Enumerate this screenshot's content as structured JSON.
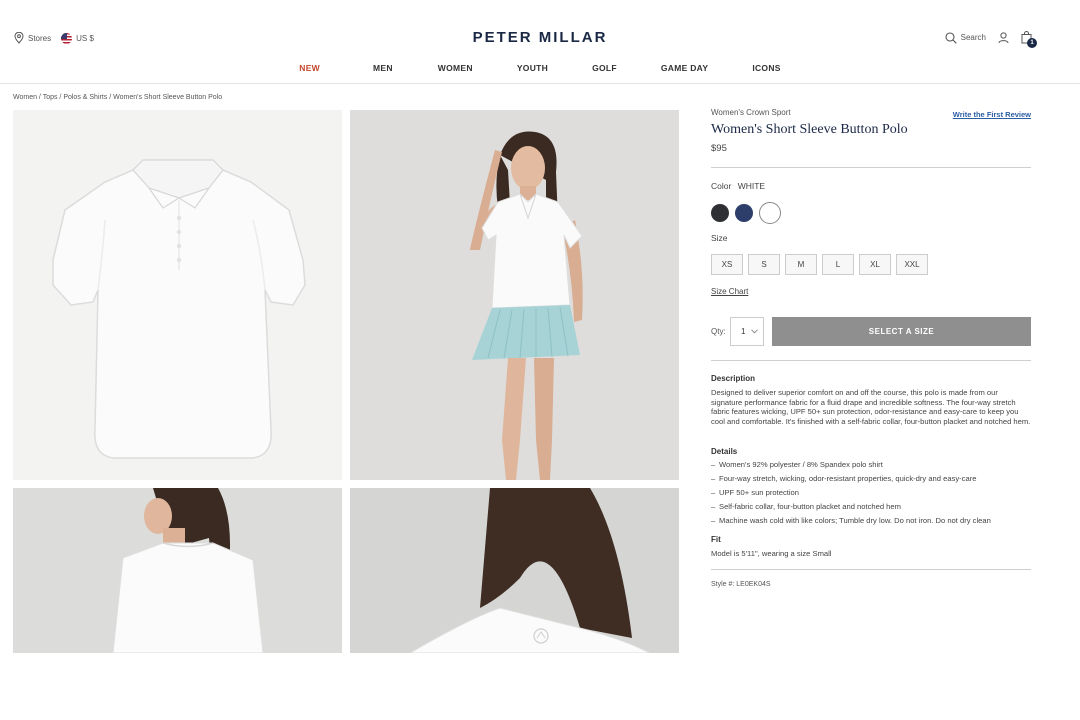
{
  "header": {
    "stores_label": "Stores",
    "currency_label": "US $",
    "logo_text": "PETER MILLAR",
    "search_label": "Search",
    "cart_count": "1"
  },
  "nav": {
    "items": [
      "NEW",
      "MEN",
      "WOMEN",
      "YOUTH",
      "GOLF",
      "GAME DAY",
      "ICONS"
    ],
    "accent_color": "#c5472c"
  },
  "breadcrumb": {
    "text": "Women / Tops / Polos & Shirts / Women's Short Sleeve Button Polo"
  },
  "product": {
    "collection": "Women's Crown Sport",
    "review_link": "Write the First Review",
    "title": "Women's Short Sleeve Button Polo",
    "price": "$95",
    "color_label": "Color",
    "color_value": "WHITE",
    "swatches": [
      "#2f3033",
      "#2d3e6b",
      "#ffffff"
    ],
    "size_label": "Size",
    "sizes": [
      "XS",
      "S",
      "M",
      "L",
      "XL",
      "XXL"
    ],
    "size_chart_label": "Size Chart",
    "qty_label": "Qty:",
    "qty_value": "1",
    "add_button_label": "SELECT A SIZE",
    "description_heading": "Description",
    "description": "Designed to deliver superior comfort on and off the course, this polo is made from our signature performance fabric for a fluid drape and incredible softness. The four-way stretch fabric features wicking, UPF 50+ sun protection, odor-resistance and easy-care to keep you cool and comfortable. It's finished with a self-fabric collar, four-button placket and notched hem.",
    "details_heading": "Details",
    "details": [
      "Women's 92% polyester / 8% Spandex polo shirt",
      "Four-way stretch, wicking, odor-resistant properties, quick-dry and easy-care",
      "UPF 50+ sun protection",
      "Self-fabric collar, four-button placket and notched hem",
      "Machine wash cold with like colors; Tumble dry low. Do not iron. Do not dry clean"
    ],
    "fit_heading": "Fit",
    "fit": "Model is 5'11\", wearing a size Small",
    "style_number": "Style #: LE0EK04S"
  }
}
